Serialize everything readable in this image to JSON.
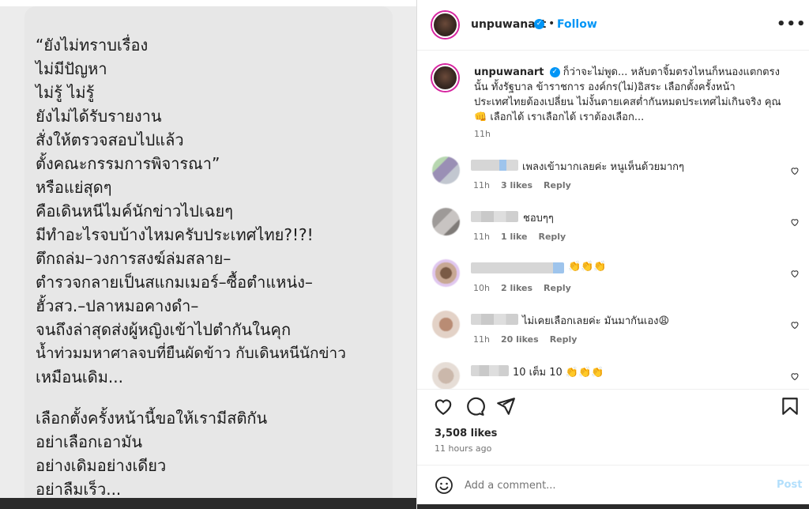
{
  "post": {
    "username": "unpuwanart",
    "follow_label": "Follow",
    "more_icon": "more-horizontal-icon",
    "caption": "ก็ว่าจะไม่พูด... หลับตาจิ้มตรงไหนก็หนองแตกตรงนั้น ทั้งรัฐบาล ข้าราชการ องค์กร(ไม่)อิสระ เลือกตั้งครั้งหน้าประเทศไทยต้องเปลี่ยน ไม่งั้นตายเคสต่ำกันหมดประเทศไม่เกินจริง คุณ👊 เลือกได้ เราเลือกได้ เราต้องเลือก...",
    "caption_time": "11h",
    "likes": "3,508 likes",
    "time_ago": "11 hours ago"
  },
  "image_text": {
    "lines": [
      "“ยังไม่ทราบเรื่อง",
      "ไม่มีปัญหา",
      "ไม่รู้  ไม่รู้",
      "ยังไม่ได้รับรายงาน",
      "สั่งให้ตรวจสอบไปแล้ว",
      "ตั้งคณะกรรมการพิจารณา”",
      "หรือแย่สุดๆ",
      "คือเดินหนีไมค์นักข่าวไปเฉยๆ",
      "มีทำอะไรจบบ้างไหมครับประเทศไทย?!?!",
      "ตึกถล่ม–วงการสงฆ์ล่มสลาย–",
      "ตำรวจกลายเป็นสแกมเมอร์–ซื้อตำแหน่ง–",
      "ฮั้วสว.–ปลาหมอคางดำ–",
      "จนถึงล่าสุดส่งผู้หญิงเข้าไปตำกันในคุก",
      "น้ำท่วมมหาศาลจบที่ยืนผัดข้าว  กับเดินหนีนักข่าว",
      "เหมือนเดิม..."
    ],
    "lines2": [
      "เลือกตั้งครั้งหน้านี้ขอให้เรามีสติกัน",
      "อย่าเลือกเอามัน",
      "อย่างเดิมอย่างเดียว",
      "อย่าลืมเร็ว..."
    ]
  },
  "comments": [
    {
      "text": "เพลงเข้ามากเลยค่ะ หนูเห็นด้วยมากๆ",
      "time": "11h",
      "likes": "3 likes",
      "reply": "Reply"
    },
    {
      "text": "ชอบๆๆ",
      "time": "11h",
      "likes": "1 like",
      "reply": "Reply"
    },
    {
      "text": "👏👏👏",
      "time": "10h",
      "likes": "2 likes",
      "reply": "Reply"
    },
    {
      "text": "ไม่เคยเลือกเลยค่ะ มันมากันเอง😩",
      "time": "11h",
      "likes": "20 likes",
      "reply": "Reply"
    },
    {
      "text": "10 เต็ม 10 👏👏👏",
      "time": "",
      "likes": "",
      "reply": ""
    }
  ],
  "add_comment": {
    "placeholder": "Add a comment...",
    "post_label": "Post"
  },
  "icons": {
    "like": "heart-icon",
    "comment": "comment-icon",
    "share": "send-icon",
    "save": "bookmark-icon",
    "emoji": "emoji-icon",
    "verified": "verified-badge-icon"
  },
  "colors": {
    "accent": "#0095f6",
    "post_disabled": "#b2dffc",
    "muted": "#737373"
  }
}
